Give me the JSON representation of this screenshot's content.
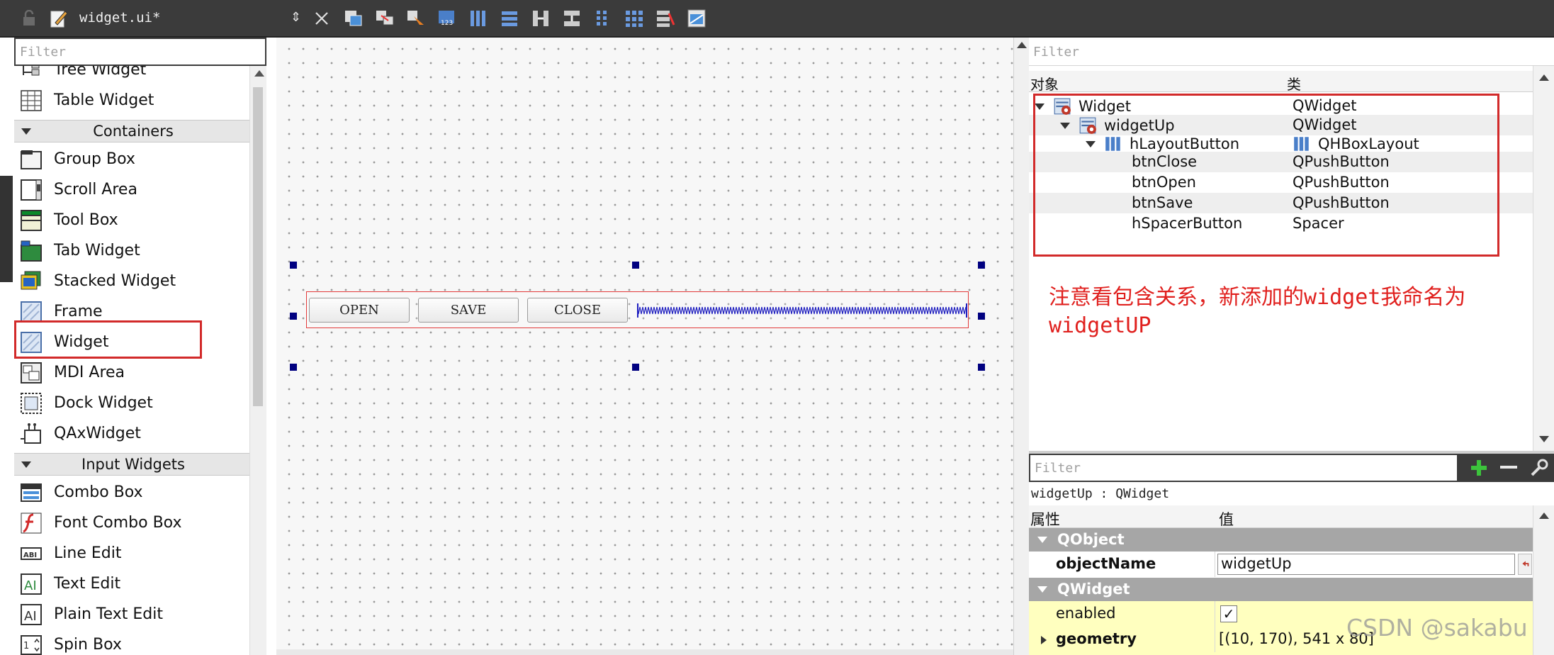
{
  "toolbar": {
    "file_title": "widget.ui*",
    "icons": [
      "edit-widgets-icon",
      "edit-signals-icon",
      "edit-buddies-icon",
      "edit-tab-order-icon",
      "layout-horizontal-icon",
      "layout-vertical-icon",
      "layout-horizontal-splitter-icon",
      "layout-vertical-splitter-icon",
      "layout-form-icon",
      "layout-grid-icon",
      "break-layout-icon",
      "adjust-size-icon"
    ]
  },
  "widget_box": {
    "filter_placeholder": "Filter",
    "items_top": [
      "Tree Widget",
      "Table Widget"
    ],
    "containers_label": "Containers",
    "containers": [
      "Group Box",
      "Scroll Area",
      "Tool Box",
      "Tab Widget",
      "Stacked Widget",
      "Frame",
      "Widget",
      "MDI Area",
      "Dock Widget",
      "QAxWidget"
    ],
    "input_label": "Input Widgets",
    "inputs": [
      "Combo Box",
      "Font Combo Box",
      "Line Edit",
      "Text Edit",
      "Plain Text Edit",
      "Spin Box"
    ]
  },
  "form": {
    "buttons": [
      "OPEN",
      "SAVE",
      "CLOSE"
    ]
  },
  "object_inspector": {
    "filter_placeholder": "Filter",
    "col_object": "对象",
    "col_class": "类",
    "rows": [
      {
        "object": "Widget",
        "class": "QWidget"
      },
      {
        "object": "widgetUp",
        "class": "QWidget"
      },
      {
        "object": "hLayoutButton",
        "class": "QHBoxLayout"
      },
      {
        "object": "btnClose",
        "class": "QPushButton"
      },
      {
        "object": "btnOpen",
        "class": "QPushButton"
      },
      {
        "object": "btnSave",
        "class": "QPushButton"
      },
      {
        "object": "hSpacerButton",
        "class": "Spacer"
      }
    ]
  },
  "annotation": {
    "part1": "注意看包含关系，新添加的",
    "code1": "widget",
    "part2": "我命名为",
    "code2": "widgetUP"
  },
  "property_editor": {
    "filter_placeholder": "Filter",
    "class_line": "widgetUp : QWidget",
    "col_property": "属性",
    "col_value": "值",
    "cat_qobject": "QObject",
    "objectname_label": "objectName",
    "objectname_value": "widgetUp",
    "cat_qwidget": "QWidget",
    "enabled_label": "enabled",
    "enabled_value": "✓",
    "geometry_label": "geometry",
    "geometry_value": "[(10, 170), 541 x 80]"
  },
  "watermark": "CSDN @sakabu",
  "colors": {
    "highlight_red": "#d22a2a",
    "annotation_red": "#e0201e",
    "selection_handle": "#000080",
    "toolbar_bg": "#3b3b3b"
  }
}
